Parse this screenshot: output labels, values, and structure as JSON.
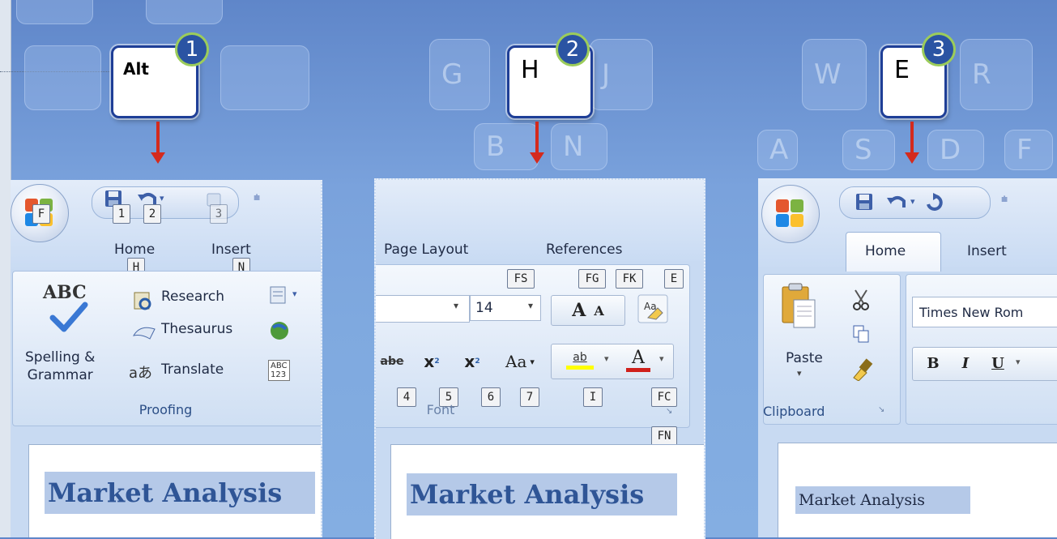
{
  "keys": [
    {
      "label": "Alt",
      "step": "1"
    },
    {
      "label": "H",
      "step": "2"
    },
    {
      "label": "E",
      "step": "3"
    }
  ],
  "keyboard_letters": [
    "G",
    "J",
    "B",
    "N",
    "W",
    "R",
    "A",
    "S",
    "D",
    "F"
  ],
  "panel1": {
    "office_keytip": "F",
    "qat_keytips": [
      "1",
      "2",
      "3"
    ],
    "tabs": [
      {
        "label": "Home",
        "keytip": "H"
      },
      {
        "label": "Insert",
        "keytip": "N"
      }
    ],
    "abc_text": "ABC",
    "spelling": [
      "Spelling &",
      "Grammar"
    ],
    "research": "Research",
    "thesaurus": "Thesaurus",
    "translate": "Translate",
    "translate_glyph": "aあ",
    "wordcount_glyph": [
      "ABC",
      "123"
    ],
    "group_label": "Proofing",
    "doc_title": "Market Analysis"
  },
  "panel2": {
    "tabs": [
      "Page Layout",
      "References"
    ],
    "keytips_top": [
      "FS",
      "FG",
      "FK",
      "E"
    ],
    "font_size": "14",
    "grow_glyph": "A",
    "shrink_glyph": "A",
    "strike_glyph": "abe",
    "sub_glyph": "x",
    "sup_glyph": "x",
    "case_glyph": "Aa",
    "highlight_glyph": "ab",
    "fontcolor_glyph": "A",
    "keytips_bottom": [
      "4",
      "5",
      "6",
      "7",
      "I",
      "FC"
    ],
    "group_label": "Font",
    "keytip_fn": "FN",
    "doc_title": "Market Analysis"
  },
  "panel3": {
    "tabs": [
      "Home",
      "Insert"
    ],
    "paste_label": "Paste",
    "clipboard_label": "Clipboard",
    "font_name": "Times New Rom",
    "bold": "B",
    "italic": "I",
    "underline": "U",
    "doc_title": "Market Analysis"
  },
  "colors": {
    "highlight_key_border": "#1f3f97",
    "step_badge_ring": "#9ccc5a",
    "arrow": "#d42a1d",
    "title_text": "#2f5596",
    "title_highlight": "#b5c9e8"
  }
}
